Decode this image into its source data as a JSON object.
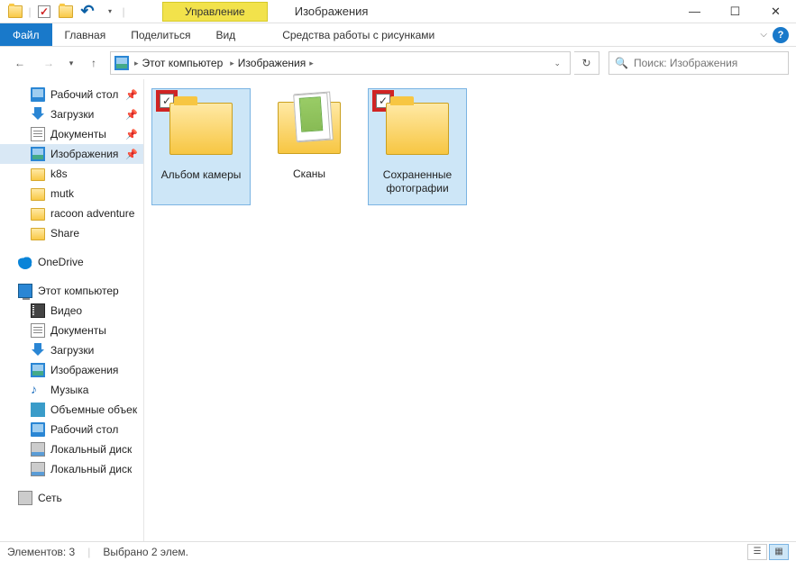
{
  "window": {
    "title": "Изображения"
  },
  "ribbon": {
    "context_label": "Управление",
    "context_tab": "Средства работы с рисунками",
    "file": "Файл",
    "tabs": [
      "Главная",
      "Поделиться",
      "Вид"
    ]
  },
  "address": {
    "root": "Этот компьютер",
    "current": "Изображения"
  },
  "search": {
    "placeholder": "Поиск: Изображения"
  },
  "nav": {
    "quick": [
      {
        "label": "Рабочий стол",
        "icon": "desktop",
        "pinned": true
      },
      {
        "label": "Загрузки",
        "icon": "download",
        "pinned": true
      },
      {
        "label": "Документы",
        "icon": "doc",
        "pinned": true
      },
      {
        "label": "Изображения",
        "icon": "pic",
        "pinned": true,
        "selected": true
      },
      {
        "label": "k8s",
        "icon": "folder"
      },
      {
        "label": "mutk",
        "icon": "folder"
      },
      {
        "label": "racoon adventure",
        "icon": "folder"
      },
      {
        "label": "Share",
        "icon": "folder"
      }
    ],
    "onedrive": "OneDrive",
    "pc": "Этот компьютер",
    "pc_children": [
      {
        "label": "Видео",
        "icon": "video"
      },
      {
        "label": "Документы",
        "icon": "doc"
      },
      {
        "label": "Загрузки",
        "icon": "download"
      },
      {
        "label": "Изображения",
        "icon": "pic"
      },
      {
        "label": "Музыка",
        "icon": "music"
      },
      {
        "label": "Объемные объек",
        "icon": "3d"
      },
      {
        "label": "Рабочий стол",
        "icon": "desktop"
      },
      {
        "label": "Локальный диск",
        "icon": "disk"
      },
      {
        "label": "Локальный диск",
        "icon": "disk"
      }
    ],
    "network": "Сеть"
  },
  "items": [
    {
      "label": "Альбом камеры",
      "type": "folder",
      "checked": true,
      "highlighted": true,
      "selected": true
    },
    {
      "label": "Сканы",
      "type": "scans",
      "checked": false,
      "highlighted": false,
      "selected": false
    },
    {
      "label": "Сохраненные фотографии",
      "type": "folder",
      "checked": true,
      "highlighted": true,
      "selected": true
    }
  ],
  "status": {
    "count_label": "Элементов: 3",
    "selected_label": "Выбрано 2 элем."
  }
}
